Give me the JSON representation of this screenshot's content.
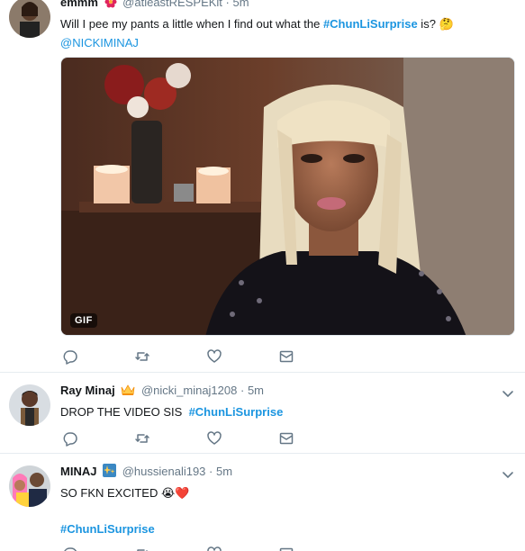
{
  "tweets": [
    {
      "name": "emmm",
      "handle": "@atleastRESPEKit",
      "dot": "·",
      "time": "5m",
      "text_prefix": "Will I pee my pants a little when I find out what the ",
      "hashtag": "#ChunLiSurprise",
      "text_suffix": " is? 🤔",
      "mention": "@NICKIMINAJ",
      "gif_label": "GIF"
    },
    {
      "name": "Ray Minaj",
      "handle": "@nicki_minaj1208",
      "dot": "·",
      "time": "5m",
      "text_prefix": "DROP THE VIDEO SIS  ",
      "hashtag": "#ChunLiSurprise"
    },
    {
      "name": "MINAJ",
      "handle": "@hussienali193",
      "dot": "·",
      "time": "5m",
      "text": "SO FKN EXCITED 😭❤️",
      "hashtag": "#ChunLiSurprise"
    }
  ],
  "colors": {
    "link": "#1b95e0",
    "icon": "#657786",
    "border": "#e6ecf0"
  },
  "icons": {
    "reply": "reply-icon",
    "retweet": "retweet-icon",
    "like": "heart-icon",
    "dm": "envelope-icon",
    "more": "chevron-down-icon"
  }
}
